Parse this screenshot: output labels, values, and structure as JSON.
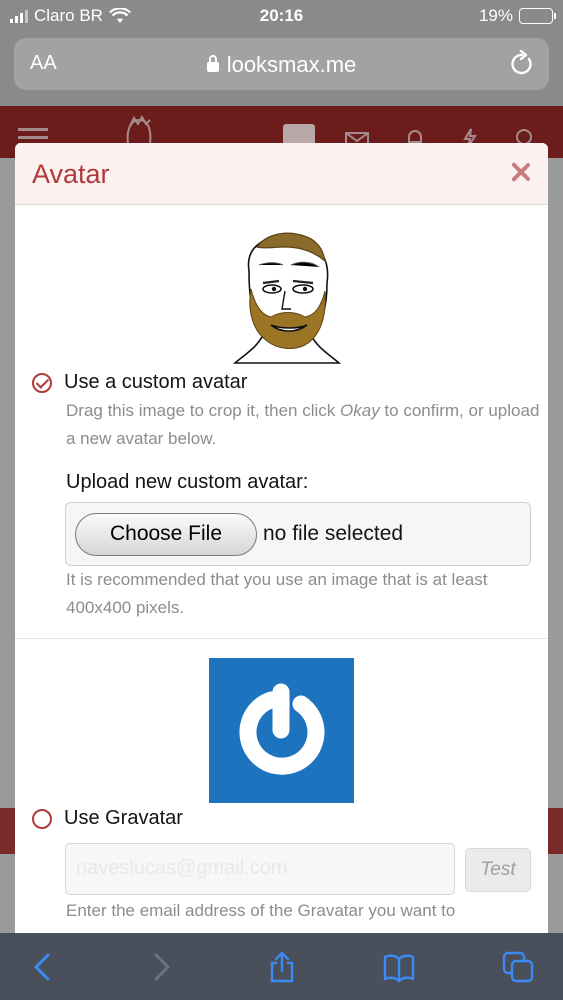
{
  "status_bar": {
    "carrier": "Claro BR",
    "time": "20:16",
    "battery": "19%"
  },
  "browser": {
    "text_size_label": "AA",
    "domain": "looksmax.me"
  },
  "modal": {
    "title": "Avatar",
    "custom_option_label": "Use a custom avatar",
    "custom_hint_before": "Drag this image to crop it, then click ",
    "custom_hint_em": "Okay",
    "custom_hint_after": " to confirm, or upload a new avatar below.",
    "upload_label": "Upload new custom avatar:",
    "choose_file_label": "Choose File",
    "no_file_text": "no file selected",
    "recommend_text": "It is recommended that you use an image that is at least 400x400 pixels.",
    "gravatar_option_label": "Use Gravatar",
    "email_value": "naveslucas@gmail.com",
    "test_label": "Test",
    "gravatar_hint": "Enter the email address of the Gravatar you want to"
  },
  "colors": {
    "accent": "#b03a3a",
    "toolbar_icon": "#3b8bf5",
    "gravatar_blue": "#1e73be"
  }
}
